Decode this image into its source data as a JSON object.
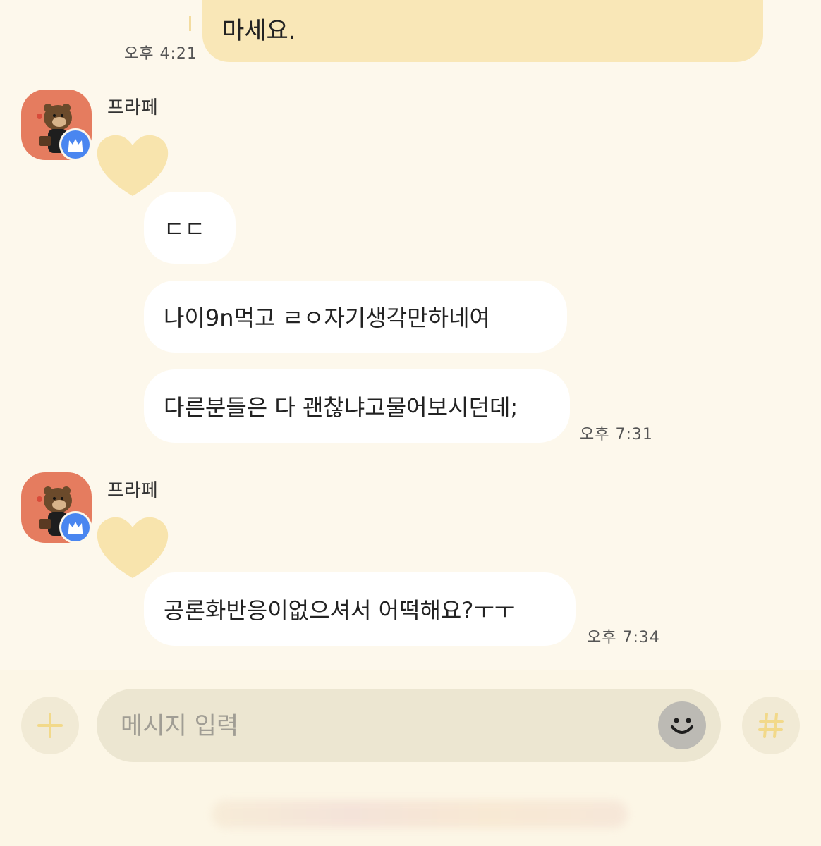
{
  "messages": {
    "mine": {
      "text": "마세요.",
      "time": "오후 4:21"
    },
    "groups": [
      {
        "sender": "프라페",
        "bubbles": [
          "ㄷㄷ",
          "나이9n먹고 ㄹㅇ자기생각만하네여",
          "다른분들은 다 괜찮냐고물어보시던데;"
        ],
        "time": "오후 7:31"
      },
      {
        "sender": "프라페",
        "bubbles": [
          "공론화반응이없으셔서 어떡해요?ㅜㅜ"
        ],
        "time": "오후 7:34"
      }
    ]
  },
  "input": {
    "placeholder": "메시지 입력",
    "plus_icon": "plus-icon",
    "emoji_icon": "smiley-icon",
    "hash_icon": "hashtag-icon"
  },
  "colors": {
    "background": "#fdf8ec",
    "my_bubble": "#f9e7b7",
    "their_bubble": "#ffffff",
    "heart": "#f8e4ad",
    "avatar_bg": "#e57c5f",
    "badge": "#4a86f0"
  }
}
